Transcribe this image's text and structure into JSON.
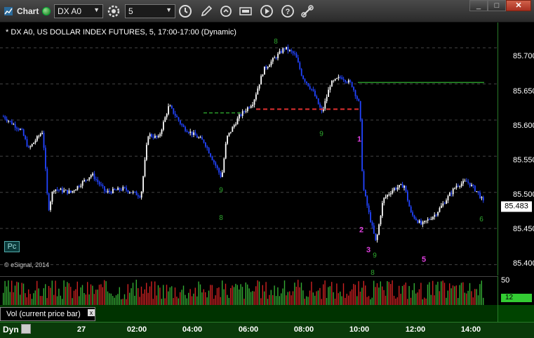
{
  "app": {
    "title": "Chart"
  },
  "toolbar": {
    "symbol": "DX A0",
    "interval": "5",
    "icons": [
      "settings-gear-icon",
      "clock-icon",
      "pencil-icon",
      "refresh-icon",
      "gif-icon",
      "play-icon",
      "help-icon",
      "link-icon"
    ]
  },
  "window_buttons": {
    "minimize": "_",
    "maximize": "□",
    "close": "✕"
  },
  "chart_title": "* DX A0, US DOLLAR INDEX FUTURES, 5, 17:00-17:00 (Dynamic)",
  "copyright": "© eSignal, 2014",
  "pc_button": "Pc",
  "price_axis": {
    "ticks": [
      "85.700",
      "85.650",
      "85.600",
      "85.550",
      "85.500",
      "85.450",
      "85.400"
    ],
    "last_price": "85.483"
  },
  "volume_axis": {
    "top_tick": "50",
    "value": "12"
  },
  "volume_label": {
    "text": "Vol (current price bar)",
    "close": "x"
  },
  "bottom": {
    "mode": "Dyn",
    "times": [
      "27",
      "02:00",
      "04:00",
      "06:00",
      "08:00",
      "10:00",
      "12:00",
      "14:00"
    ]
  },
  "chart_data": {
    "type": "candlestick",
    "instrument": "DX A0",
    "interval": "5",
    "ylim": [
      85.385,
      85.735
    ],
    "annotations": [
      "8",
      "9",
      "1",
      "2",
      "3",
      "5",
      "6",
      "7"
    ],
    "levels": [
      {
        "color": "#2a9a2a",
        "value": 85.61
      },
      {
        "color": "#e03030",
        "value": 85.615
      },
      {
        "color": "#2a9a2a",
        "value": 85.652
      }
    ]
  }
}
